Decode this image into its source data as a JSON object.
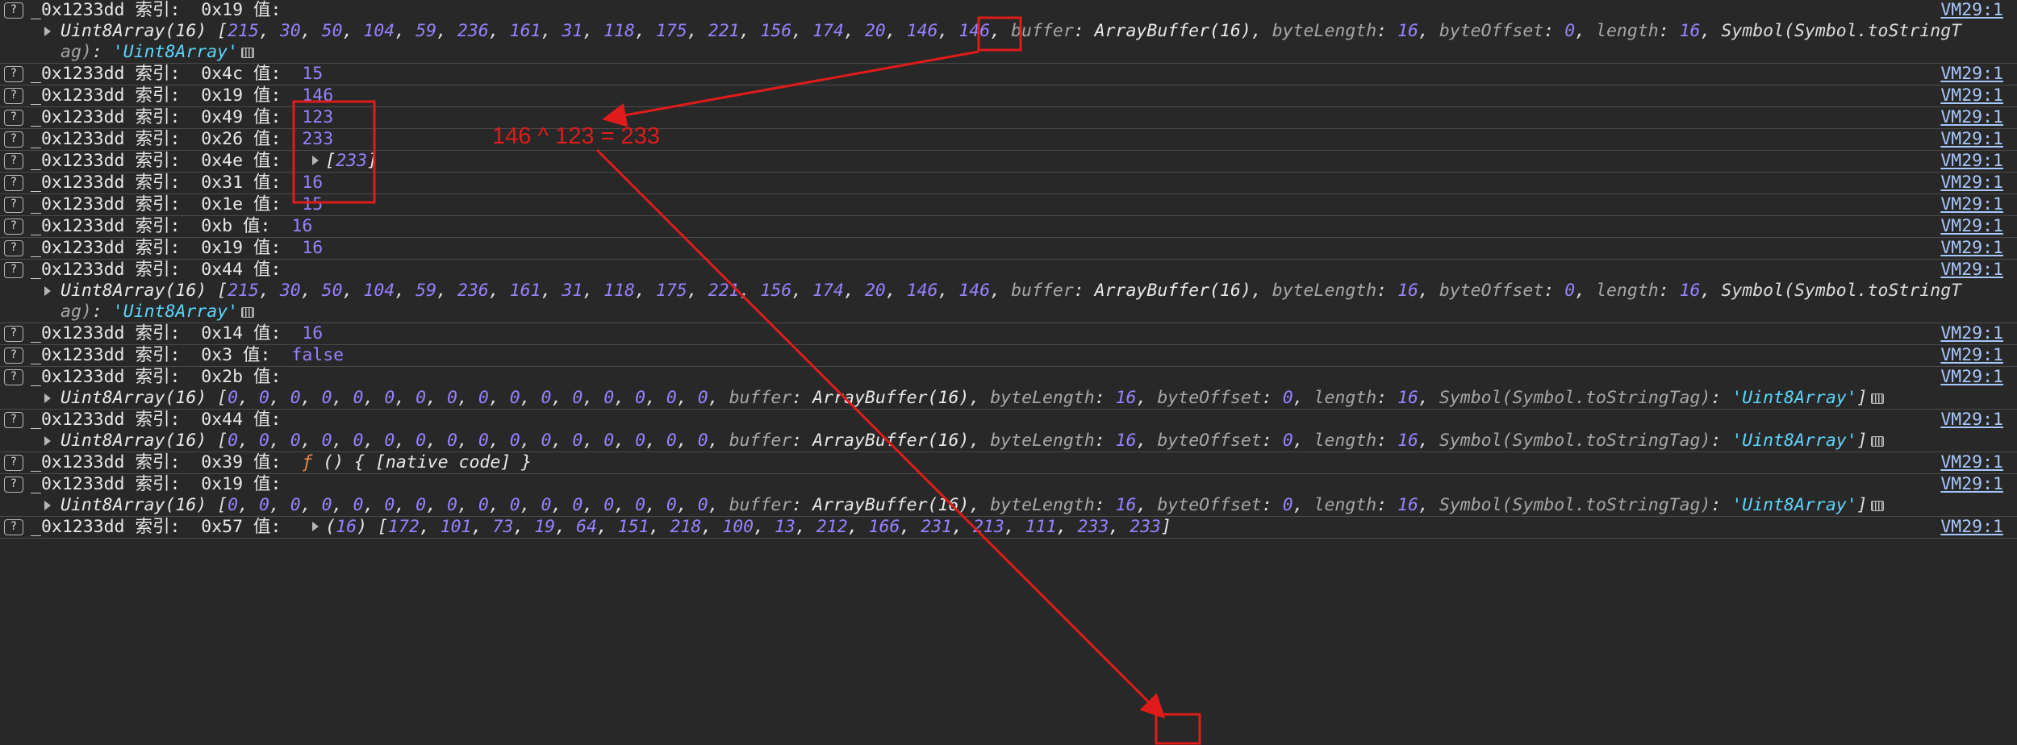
{
  "vm_link": "VM29:1",
  "prefix": "_0x1233dd 索引:",
  "value_label": "值:",
  "ta16": "Uint8Array(16)",
  "ta_after": "buffer: ArrayBuffer(16), byteLength: 16, byteOffset: 0, length: 16, Symbol(Symbol.toStringTag): 'Uint8Array'",
  "rows": [
    {
      "index": "0x19",
      "value": "",
      "obj": "[215, 30, 50, 104, 59, 236, 161, 31, 118, 175, 221, 156, 174, 20, 146, 146, buffer: ArrayBuffer(16), byteLength: 16, byteOffset: 0, length: 16, Symbol(Symbol.toStringT",
      "obj_cont": "ag): 'Uint8Array'"
    },
    {
      "index": "0x4c",
      "value": "15"
    },
    {
      "index": "0x19",
      "value": "146"
    },
    {
      "index": "0x49",
      "value": "123"
    },
    {
      "index": "0x26",
      "value": "233"
    },
    {
      "index": "0x4e",
      "value": "[233]"
    },
    {
      "index": "0x31",
      "value": "16"
    },
    {
      "index": "0x1e",
      "value": "15"
    },
    {
      "index": "0xb",
      "value": "16"
    },
    {
      "index": "0x19",
      "value": "16"
    },
    {
      "index": "0x44",
      "value": "",
      "obj": "[215, 30, 50, 104, 59, 236, 161, 31, 118, 175, 221, 156, 174, 20, 146, 146, buffer: ArrayBuffer(16), byteLength: 16, byteOffset: 0, length: 16, Symbol(Symbol.toStringT",
      "obj_cont": "ag): 'Uint8Array'"
    },
    {
      "index": "0x14",
      "value": "16"
    },
    {
      "index": "0x3",
      "value": "false"
    },
    {
      "index": "0x2b",
      "value": "",
      "obj": "[0, 0, 0, 0, 0, 0, 0, 0, 0, 0, 0, 0, 0, 0, 0, 0, buffer: ArrayBuffer(16), byteLength: 16, byteOffset: 0, length: 16, Symbol(Symbol.toStringTag): 'Uint8Array']"
    },
    {
      "index": "0x44",
      "value": "",
      "obj": "[0, 0, 0, 0, 0, 0, 0, 0, 0, 0, 0, 0, 0, 0, 0, 0, buffer: ArrayBuffer(16), byteLength: 16, byteOffset: 0, length: 16, Symbol(Symbol.toStringTag): 'Uint8Array']"
    },
    {
      "index": "0x39",
      "value": "ƒ () { [native code] }"
    },
    {
      "index": "0x19",
      "value": "",
      "obj": "[0, 0, 0, 0, 0, 0, 0, 0, 0, 0, 0, 0, 0, 0, 0, 0, buffer: ArrayBuffer(16), byteLength: 16, byteOffset: 0, length: 16, Symbol(Symbol.toStringTag): 'Uint8Array']"
    },
    {
      "index": "0x57",
      "value": "(16) [172, 101, 73, 19, 64, 151, 218, 100, 13, 212, 166, 231, 213, 111, 233, 233]"
    }
  ],
  "annotation": {
    "text": "146 ^ 123 = 233",
    "color": "#e01b1b"
  }
}
